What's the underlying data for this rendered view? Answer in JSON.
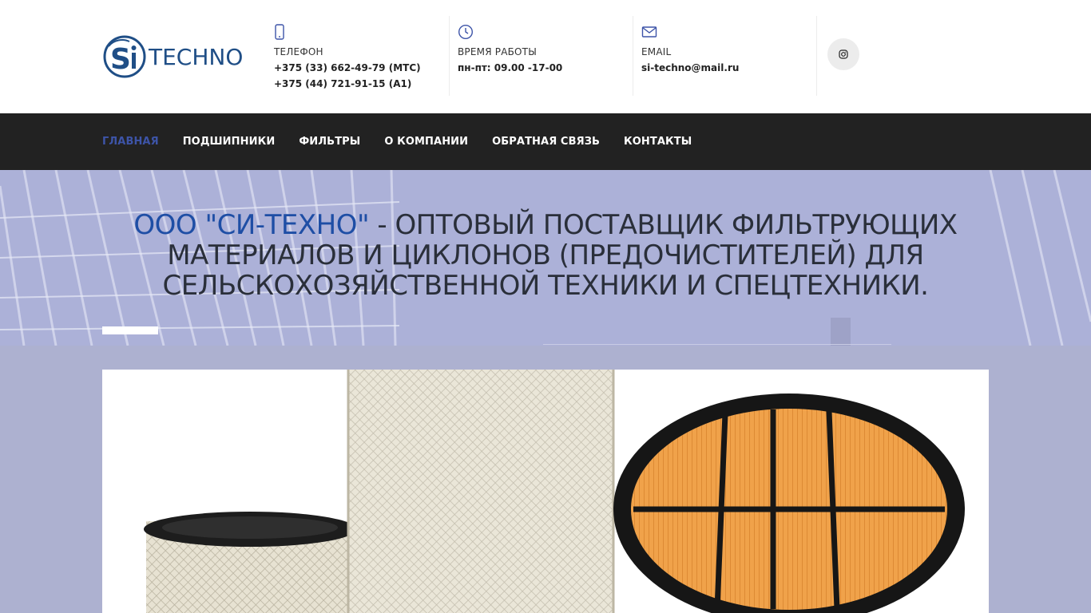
{
  "logo": {
    "text": "TECHNO"
  },
  "contacts": {
    "phone": {
      "label": "ТЕЛЕФОН",
      "line1": "+375 (33) 662-49-79 (МТС)",
      "line2": "+375 (44) 721-91-15 (А1)"
    },
    "hours": {
      "label": "ВРЕМЯ РАБОТЫ",
      "line1": "пн-пт: 09.00 -17-00"
    },
    "email": {
      "label": "EMAIL",
      "line1": "si-techno@mail.ru"
    }
  },
  "social": {
    "icon": "instagram-icon"
  },
  "nav": {
    "items": [
      {
        "label": "ГЛАВНАЯ",
        "active": true
      },
      {
        "label": "ПОДШИПНИКИ"
      },
      {
        "label": "ФИЛЬТРЫ"
      },
      {
        "label": "О КОМПАНИИ"
      },
      {
        "label": "ОБРАТНАЯ СВЯЗЬ"
      },
      {
        "label": "КОНТАКТЫ"
      }
    ]
  },
  "hero": {
    "brand": "ООО \"СИ-ТЕХНО\"",
    "title_rest": " - ОПТОВЫЙ ПОСТАВЩИК ФИЛЬТРУЮЩИХ МАТЕРИАЛОВ И ЦИКЛОНОВ (ПРЕДОЧИСТИТЕЛЕЙ) ДЛЯ СЕЛЬСКОХОЗЯЙСТВЕННОЙ ТЕХНИКИ И СПЕЦТЕХНИКИ."
  },
  "colors": {
    "accent": "#3d54a8",
    "brand": "#1e4ea5",
    "nav_bg": "#222222",
    "hero_bg": "#acb1d8",
    "page_bg": "#adb1d0"
  }
}
